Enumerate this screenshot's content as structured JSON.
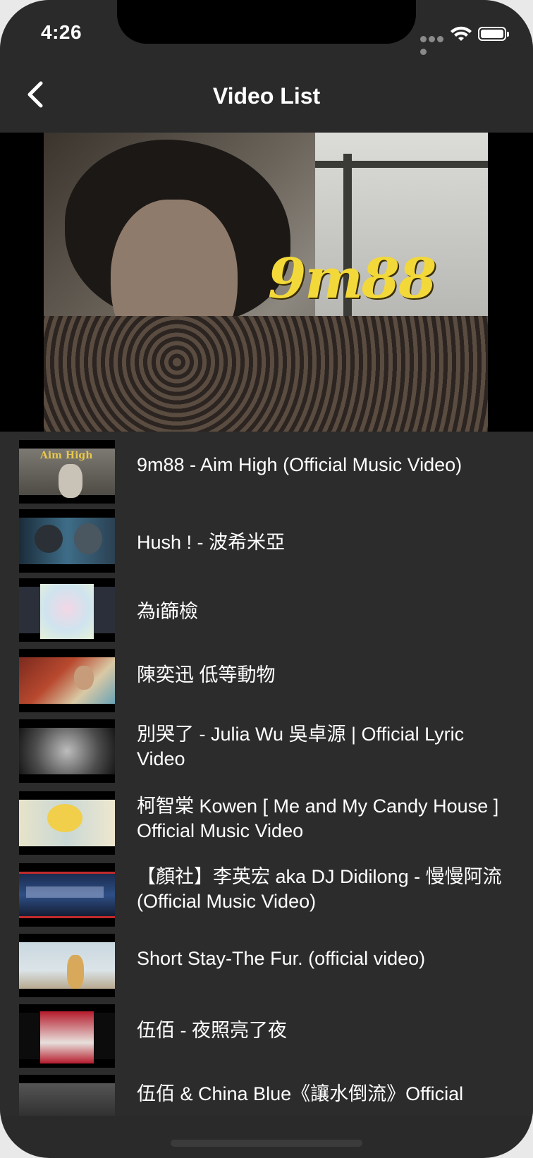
{
  "status_bar": {
    "time": "4:26"
  },
  "nav": {
    "title": "Video List",
    "back_icon": "chevron-left-icon"
  },
  "player": {
    "overlay_text": "9m88"
  },
  "videos": [
    {
      "title": "9m88 - Aim High (Official Music Video)",
      "thumb_text": "Aim High"
    },
    {
      "title": "Hush ! - 波希米亞"
    },
    {
      "title": "為i篩檢"
    },
    {
      "title": "陳奕迅 低等動物"
    },
    {
      "title": "別哭了 - Julia Wu 吳卓源 | Official Lyric Video"
    },
    {
      "title": "柯智棠 Kowen [ Me and My Candy House ] Official Music Video"
    },
    {
      "title": "【顏社】李英宏 aka DJ Didilong - 慢慢阿流 (Official Music Video)"
    },
    {
      "title": "Short Stay-The Fur. (official video)"
    },
    {
      "title": "伍佰 - 夜照亮了夜"
    },
    {
      "title": "伍佰 & China Blue《讓水倒流》Official"
    }
  ]
}
